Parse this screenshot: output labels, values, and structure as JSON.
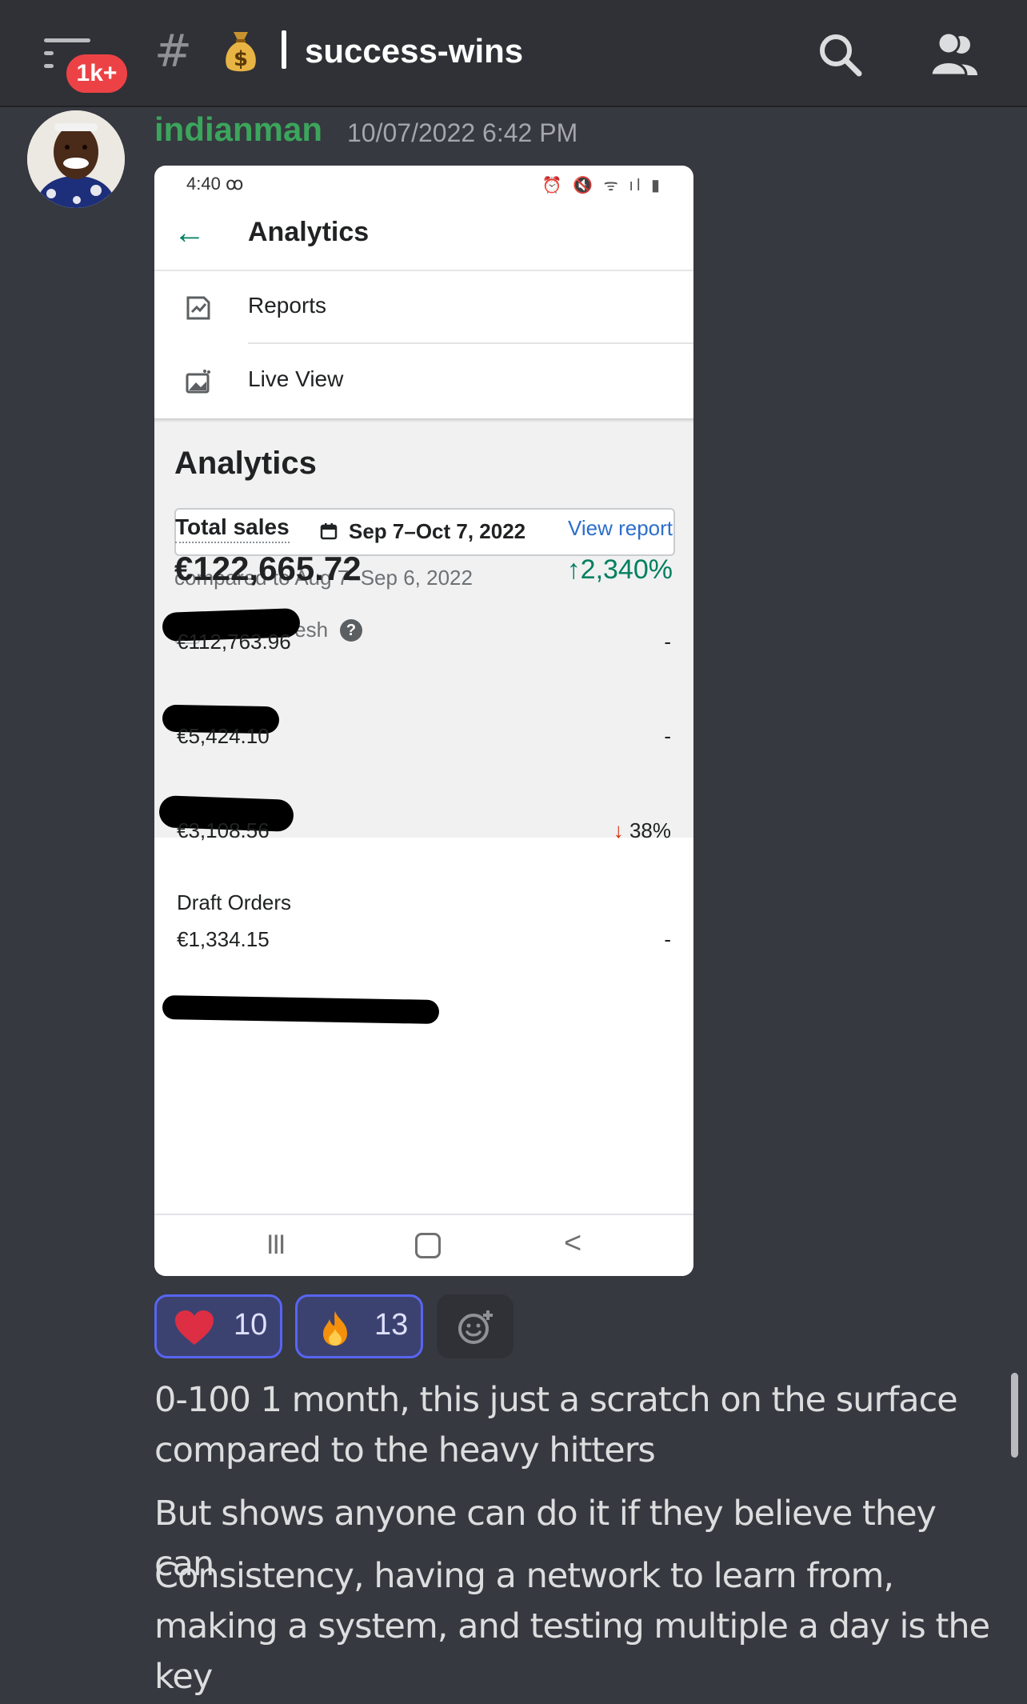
{
  "header": {
    "unread_badge": "1k+",
    "channel_emoji": "money-bag",
    "channel_name": "success-wins"
  },
  "message": {
    "author": "indianman",
    "author_color": "#3ba55c",
    "timestamp": "10/07/2022 6:42 PM",
    "screenshot": {
      "status_time": "4:40",
      "status_icons": "⏰ 🔇 ᯤ ıl ▮",
      "app_title": "Analytics",
      "menu": [
        {
          "label": "Reports",
          "icon": "reports-icon"
        },
        {
          "label": "Live View",
          "icon": "live-view-icon"
        }
      ],
      "section_title": "Analytics",
      "date_range": "Sep 7–Oct 7, 2022",
      "compared_to": "compared to Aug 7–Sep 6, 2022",
      "auto_refresh_label": "Auto-refresh",
      "auto_refresh_checked": false,
      "total_sales_label": "Total sales",
      "view_report_label": "View report",
      "total_sales_value": "€122,665.72",
      "total_sales_change": "↑2,340%",
      "rows": [
        {
          "name_redacted": true,
          "value": "€112,763.96",
          "change": "-"
        },
        {
          "name_redacted": true,
          "value": "€5,424.10",
          "change": "-"
        },
        {
          "name_redacted": true,
          "value": "€3,108.56",
          "change_arrow": "↓",
          "change": "38%"
        },
        {
          "name": "Draft Orders",
          "value": "€1,334.15",
          "change": "-"
        }
      ],
      "nav": {
        "recents": "III",
        "back": "<"
      }
    },
    "reactions": [
      {
        "emoji": "heart",
        "count": "10"
      },
      {
        "emoji": "fire",
        "count": "13"
      }
    ],
    "paragraphs": [
      "0-100 1 month, this just a scratch on the surface compared to the heavy hitters",
      "But shows anyone can do it if they believe they can",
      "Consistency, having a network to learn from, making a system, and testing multiple a day is the key"
    ]
  },
  "colors": {
    "background": "#36393f",
    "accent_green": "#008060",
    "link_blue": "#2c6ecb",
    "reaction_border": "#5865f2",
    "badge_red": "#ed4245"
  }
}
